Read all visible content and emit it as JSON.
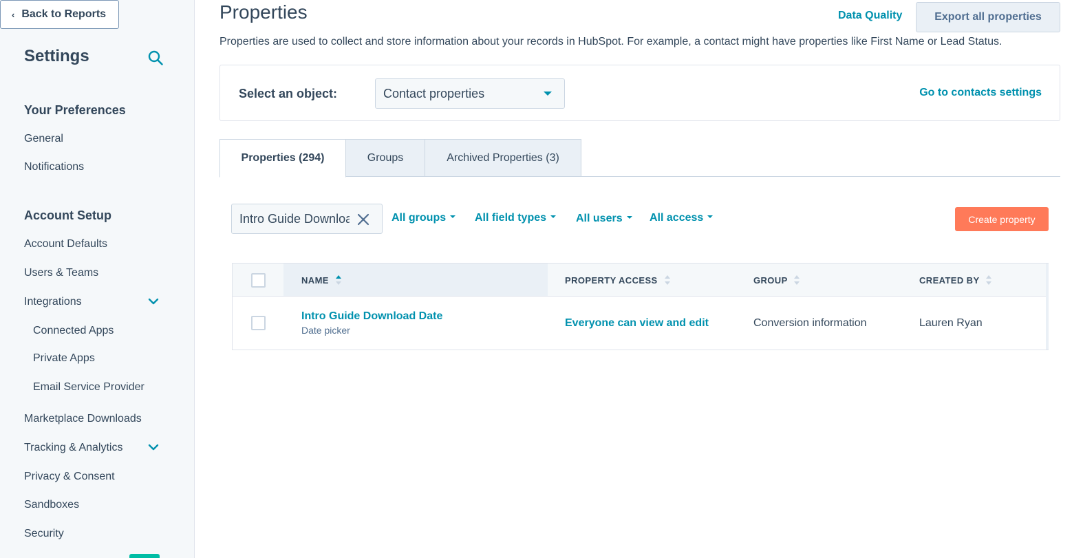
{
  "sidebar": {
    "back_label": "Back to Reports",
    "title": "Settings",
    "sections": [
      {
        "heading": "Your Preferences",
        "items": [
          "General",
          "Notifications"
        ]
      },
      {
        "heading": "Account Setup",
        "items": [
          "Account Defaults",
          "Users & Teams",
          "Integrations",
          "Connected Apps",
          "Private Apps",
          "Email Service Provider",
          "Marketplace Downloads",
          "Tracking & Analytics",
          "Privacy & Consent",
          "Sandboxes",
          "Security"
        ]
      }
    ]
  },
  "header": {
    "title": "Properties",
    "data_quality_label": "Data Quality",
    "export_label": "Export all properties",
    "description": "Properties are used to collect and store information about your records in HubSpot. For example, a contact might have properties like First Name or Lead Status."
  },
  "object_selector": {
    "label": "Select an object:",
    "selected": "Contact properties",
    "settings_link": "Go to contacts settings"
  },
  "tabs": [
    {
      "label": "Properties (294)",
      "active": true
    },
    {
      "label": "Groups",
      "active": false
    },
    {
      "label": "Archived Properties (3)",
      "active": false
    }
  ],
  "filters": {
    "search_value": "Intro Guide Download Date",
    "groups": "All groups",
    "field_types": "All field types",
    "users": "All users",
    "access": "All access",
    "create_label": "Create property"
  },
  "table": {
    "columns": [
      "NAME",
      "PROPERTY ACCESS",
      "GROUP",
      "CREATED BY"
    ],
    "rows": [
      {
        "name": "Intro Guide Download Date",
        "type": "Date picker",
        "access": "Everyone can view and edit",
        "group": "Conversion information",
        "created_by": "Lauren Ryan"
      }
    ]
  },
  "colors": {
    "link": "#0091ae",
    "primary_button": "#ff7a59",
    "text": "#33475b",
    "sidebar_bg": "#f5f8fa"
  }
}
